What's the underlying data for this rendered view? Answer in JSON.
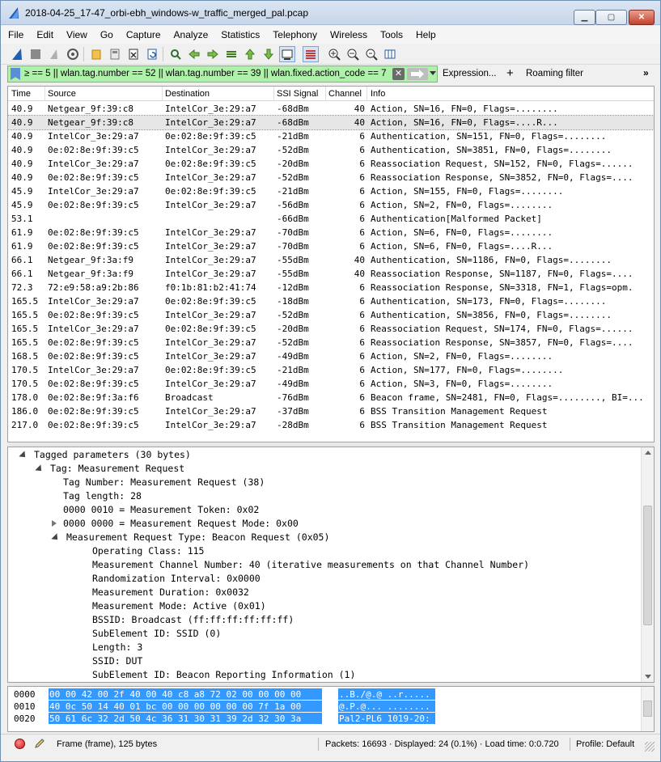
{
  "window": {
    "title": "2018-04-25_17-47_orbi-ebh_windows-w_traffic_merged_pal.pcap",
    "min_label": "▁",
    "max_label": "▢",
    "close_label": "✕"
  },
  "menu": [
    "File",
    "Edit",
    "View",
    "Go",
    "Capture",
    "Analyze",
    "Statistics",
    "Telephony",
    "Wireless",
    "Tools",
    "Help"
  ],
  "toolbar": {
    "icons": [
      "shark-fin-icon",
      "stop-icon",
      "restart-icon",
      "options-icon",
      "open-file-icon",
      "save-icon",
      "close-file-icon",
      "reload-icon",
      "find-icon",
      "back-icon",
      "forward-icon",
      "goto-icon",
      "first-icon",
      "last-icon",
      "autoscroll-icon",
      "colorize-icon",
      "zoom-in-icon",
      "zoom-out-icon",
      "zoom-reset-icon",
      "resize-columns-icon"
    ]
  },
  "filter": {
    "value": "≥ == 5 || wlan.tag.number == 52 || wlan.tag.number == 39 || wlan.fixed.action_code == 7",
    "clear_label": "✕",
    "expression_label": "Expression...",
    "plus_label": "+",
    "roaming_label": "Roaming filter",
    "more_label": "»",
    "color": "#aff1aa"
  },
  "packet_list": {
    "columns": [
      "Time",
      "Source",
      "Destination",
      "SSI Signal",
      "Channel",
      "Info"
    ],
    "selected_index": 1,
    "rows": [
      {
        "time": "40.9",
        "src": "Netgear_9f:39:c8",
        "dst": "IntelCor_3e:29:a7",
        "sig": "-68dBm",
        "ch": "40",
        "info": "Action, SN=16, FN=0, Flags=........"
      },
      {
        "time": "40.9",
        "src": "Netgear_9f:39:c8",
        "dst": "IntelCor_3e:29:a7",
        "sig": "-68dBm",
        "ch": "40",
        "info": "Action, SN=16, FN=0, Flags=....R..."
      },
      {
        "time": "40.9",
        "src": "IntelCor_3e:29:a7",
        "dst": "0e:02:8e:9f:39:c5",
        "sig": "-21dBm",
        "ch": "6",
        "info": "Authentication, SN=151, FN=0, Flags=........"
      },
      {
        "time": "40.9",
        "src": "0e:02:8e:9f:39:c5",
        "dst": "IntelCor_3e:29:a7",
        "sig": "-52dBm",
        "ch": "6",
        "info": "Authentication, SN=3851, FN=0, Flags=........"
      },
      {
        "time": "40.9",
        "src": "IntelCor_3e:29:a7",
        "dst": "0e:02:8e:9f:39:c5",
        "sig": "-20dBm",
        "ch": "6",
        "info": "Reassociation Request, SN=152, FN=0, Flags=......"
      },
      {
        "time": "40.9",
        "src": "0e:02:8e:9f:39:c5",
        "dst": "IntelCor_3e:29:a7",
        "sig": "-52dBm",
        "ch": "6",
        "info": "Reassociation Response, SN=3852, FN=0, Flags=...."
      },
      {
        "time": "45.9",
        "src": "IntelCor_3e:29:a7",
        "dst": "0e:02:8e:9f:39:c5",
        "sig": "-21dBm",
        "ch": "6",
        "info": "Action, SN=155, FN=0, Flags=........"
      },
      {
        "time": "45.9",
        "src": "0e:02:8e:9f:39:c5",
        "dst": "IntelCor_3e:29:a7",
        "sig": "-56dBm",
        "ch": "6",
        "info": "Action, SN=2, FN=0, Flags=........"
      },
      {
        "time": "53.1",
        "src": "",
        "dst": "",
        "sig": "-66dBm",
        "ch": "6",
        "info": "Authentication[Malformed Packet]"
      },
      {
        "time": "61.9",
        "src": "0e:02:8e:9f:39:c5",
        "dst": "IntelCor_3e:29:a7",
        "sig": "-70dBm",
        "ch": "6",
        "info": "Action, SN=6, FN=0, Flags=........"
      },
      {
        "time": "61.9",
        "src": "0e:02:8e:9f:39:c5",
        "dst": "IntelCor_3e:29:a7",
        "sig": "-70dBm",
        "ch": "6",
        "info": "Action, SN=6, FN=0, Flags=....R..."
      },
      {
        "time": "66.1",
        "src": "Netgear_9f:3a:f9",
        "dst": "IntelCor_3e:29:a7",
        "sig": "-55dBm",
        "ch": "40",
        "info": "Authentication, SN=1186, FN=0, Flags=........"
      },
      {
        "time": "66.1",
        "src": "Netgear_9f:3a:f9",
        "dst": "IntelCor_3e:29:a7",
        "sig": "-55dBm",
        "ch": "40",
        "info": "Reassociation Response, SN=1187, FN=0, Flags=...."
      },
      {
        "time": "72.3",
        "src": "72:e9:58:a9:2b:86",
        "dst": "f0:1b:81:b2:41:74",
        "sig": "-12dBm",
        "ch": "6",
        "info": "Reassociation Response, SN=3318, FN=1, Flags=opm."
      },
      {
        "time": "165.5",
        "src": "IntelCor_3e:29:a7",
        "dst": "0e:02:8e:9f:39:c5",
        "sig": "-18dBm",
        "ch": "6",
        "info": "Authentication, SN=173, FN=0, Flags=........"
      },
      {
        "time": "165.5",
        "src": "0e:02:8e:9f:39:c5",
        "dst": "IntelCor_3e:29:a7",
        "sig": "-52dBm",
        "ch": "6",
        "info": "Authentication, SN=3856, FN=0, Flags=........"
      },
      {
        "time": "165.5",
        "src": "IntelCor_3e:29:a7",
        "dst": "0e:02:8e:9f:39:c5",
        "sig": "-20dBm",
        "ch": "6",
        "info": "Reassociation Request, SN=174, FN=0, Flags=......"
      },
      {
        "time": "165.5",
        "src": "0e:02:8e:9f:39:c5",
        "dst": "IntelCor_3e:29:a7",
        "sig": "-52dBm",
        "ch": "6",
        "info": "Reassociation Response, SN=3857, FN=0, Flags=...."
      },
      {
        "time": "168.5",
        "src": "0e:02:8e:9f:39:c5",
        "dst": "IntelCor_3e:29:a7",
        "sig": "-49dBm",
        "ch": "6",
        "info": "Action, SN=2, FN=0, Flags=........"
      },
      {
        "time": "170.5",
        "src": "IntelCor_3e:29:a7",
        "dst": "0e:02:8e:9f:39:c5",
        "sig": "-21dBm",
        "ch": "6",
        "info": "Action, SN=177, FN=0, Flags=........"
      },
      {
        "time": "170.5",
        "src": "0e:02:8e:9f:39:c5",
        "dst": "IntelCor_3e:29:a7",
        "sig": "-49dBm",
        "ch": "6",
        "info": "Action, SN=3, FN=0, Flags=........"
      },
      {
        "time": "178.0",
        "src": "0e:02:8e:9f:3a:f6",
        "dst": "Broadcast",
        "sig": "-76dBm",
        "ch": "6",
        "info": "Beacon frame, SN=2481, FN=0, Flags=........, BI=..."
      },
      {
        "time": "186.0",
        "src": "0e:02:8e:9f:39:c5",
        "dst": "IntelCor_3e:29:a7",
        "sig": "-37dBm",
        "ch": "6",
        "info": "BSS Transition Management Request"
      },
      {
        "time": "217.0",
        "src": "0e:02:8e:9f:39:c5",
        "dst": "IntelCor_3e:29:a7",
        "sig": "-28dBm",
        "ch": "6",
        "info": "BSS Transition Management Request"
      }
    ]
  },
  "details": [
    {
      "text": "Tagged parameters (30 bytes)",
      "depth": 0,
      "toggle": "open"
    },
    {
      "text": "Tag: Measurement Request",
      "depth": 1,
      "toggle": "open"
    },
    {
      "text": "Tag Number: Measurement Request (38)",
      "depth": 2,
      "toggle": "none"
    },
    {
      "text": "Tag length: 28",
      "depth": 2,
      "toggle": "none"
    },
    {
      "text": "0000 0010 = Measurement Token: 0x02",
      "depth": 2,
      "toggle": "none"
    },
    {
      "text": "0000 0000 = Measurement Request Mode: 0x00",
      "depth": 2,
      "toggle": "closed"
    },
    {
      "text": "Measurement Request Type: Beacon Request (0x05)",
      "depth": 2,
      "toggle": "open"
    },
    {
      "text": "Operating Class: 115",
      "depth": 3,
      "toggle": "none"
    },
    {
      "text": "Measurement Channel Number: 40 (iterative measurements on that Channel Number)",
      "depth": 3,
      "toggle": "none"
    },
    {
      "text": "Randomization Interval: 0x0000",
      "depth": 3,
      "toggle": "none"
    },
    {
      "text": "Measurement Duration: 0x0032",
      "depth": 3,
      "toggle": "none"
    },
    {
      "text": "Measurement Mode: Active (0x01)",
      "depth": 3,
      "toggle": "none"
    },
    {
      "text": "BSSID: Broadcast (ff:ff:ff:ff:ff:ff)",
      "depth": 3,
      "toggle": "none"
    },
    {
      "text": "SubElement ID: SSID (0)",
      "depth": 3,
      "toggle": "none"
    },
    {
      "text": "Length: 3",
      "depth": 3,
      "toggle": "none"
    },
    {
      "text": "SSID: DUT",
      "depth": 3,
      "toggle": "none"
    },
    {
      "text": "SubElement ID: Beacon Reporting Information (1)",
      "depth": 3,
      "toggle": "none"
    }
  ],
  "bytes": [
    {
      "offset": "0000",
      "hex": "00 00 42 00 2f 40 00 40  c8 a8 72 02 00 00 00 00",
      "ascii": "..B./@.@ ..r....."
    },
    {
      "offset": "0010",
      "hex": "40 0c 50 14 40 01 bc 00  00 00 00 00 00 7f 1a 00",
      "ascii": "@.P.@... ........"
    },
    {
      "offset": "0020",
      "hex": "50 61 6c 32 2d 50 4c 36  31 30 31 39 2d 32 30 3a",
      "ascii": "Pal2-PL6 1019-20:"
    }
  ],
  "status": {
    "frame": "Frame (frame), 125 bytes",
    "packets": "Packets: 16693 · Displayed: 24 (0.1%) · Load time: 0:0.720",
    "profile": "Profile: Default"
  },
  "colors": {
    "selection": "#3399ff",
    "filter_valid": "#aff1aa",
    "selected_row": "#e6e6e6"
  }
}
